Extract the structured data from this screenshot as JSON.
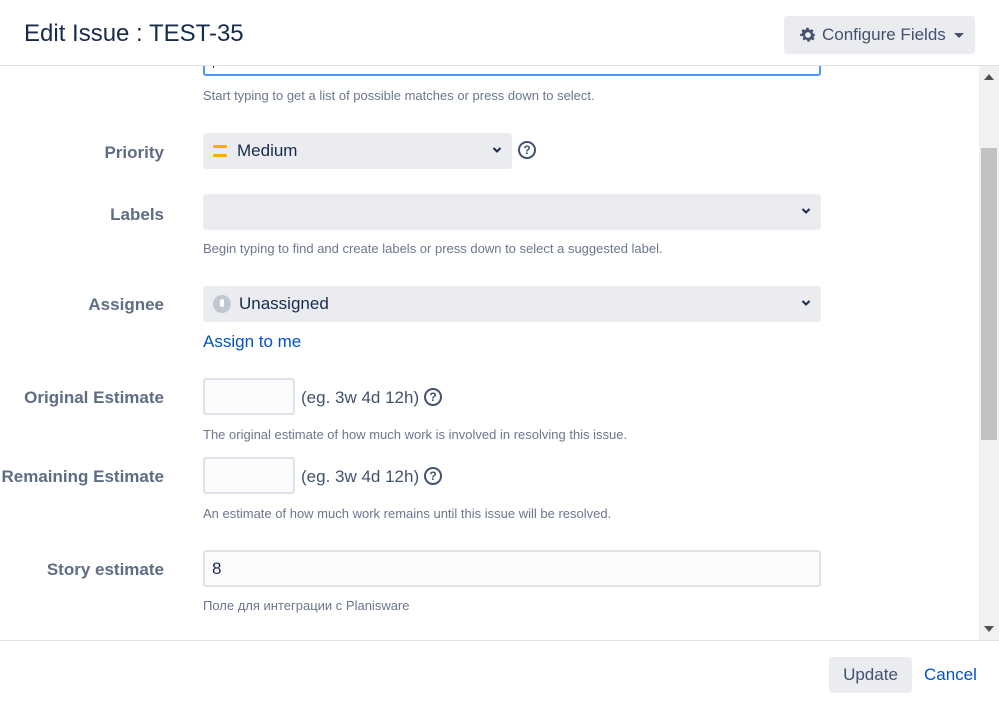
{
  "header": {
    "title": "Edit Issue : TEST-35",
    "configure_fields_label": "Configure Fields"
  },
  "form": {
    "versions_hint": "Start typing to get a list of possible matches or press down to select.",
    "priority": {
      "label": "Priority",
      "value": "Medium",
      "color": "#ffab00"
    },
    "labels": {
      "label": "Labels",
      "value": "",
      "hint": "Begin typing to find and create labels or press down to select a suggested label."
    },
    "assignee": {
      "label": "Assignee",
      "value": "Unassigned",
      "assign_to_me": "Assign to me"
    },
    "original_estimate": {
      "label": "Original Estimate",
      "value": "",
      "hint_inline": "(eg. 3w 4d 12h)",
      "description": "The original estimate of how much work is involved in resolving this issue."
    },
    "remaining_estimate": {
      "label": "Remaining Estimate",
      "value": "",
      "hint_inline": "(eg. 3w 4d 12h)",
      "description": "An estimate of how much work remains until this issue will be resolved."
    },
    "story_estimate": {
      "label": "Story estimate",
      "value": "8",
      "description": "Поле для интеграции с Planisware"
    }
  },
  "footer": {
    "update_label": "Update",
    "cancel_label": "Cancel"
  },
  "icons": {
    "gear": "gear-icon",
    "chevron": "chevron-down-icon",
    "help": "help-icon",
    "priority": "priority-medium-icon",
    "avatar": "unassigned-avatar-icon"
  },
  "colors": {
    "link": "#0052cc",
    "focus": "#4c9aff",
    "label": "#5e6c84"
  }
}
